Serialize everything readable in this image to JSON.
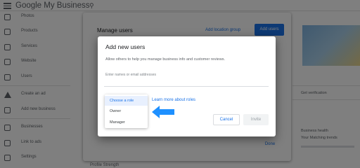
{
  "app": {
    "brand": "Google My Business"
  },
  "sidebar": {
    "items": [
      {
        "label": "Photos",
        "icon": "photo-icon"
      },
      {
        "label": "Products",
        "icon": "products-icon"
      },
      {
        "label": "Services",
        "icon": "services-icon"
      },
      {
        "label": "Website",
        "icon": "website-icon"
      },
      {
        "label": "Users",
        "icon": "users-icon"
      },
      {
        "label": "Create an ad",
        "icon": "ads-icon"
      },
      {
        "label": "Add new business",
        "icon": "add-business-icon"
      },
      {
        "label": "Businesses",
        "icon": "businesses-icon"
      },
      {
        "label": "Link to ads",
        "icon": "link-icon"
      },
      {
        "label": "Settings",
        "icon": "settings-icon"
      }
    ]
  },
  "manage_users": {
    "title": "Manage users",
    "add_location_group": "Add location group",
    "add_users": "Add users",
    "done": "Done"
  },
  "right_panel": {
    "item1": "Get verification",
    "item2": "Business health",
    "item3": "Your Matching trends"
  },
  "bottom": {
    "text": "Profile Strength"
  },
  "dialog": {
    "title": "Add new users",
    "description": "Allow others to help you manage business info and customer reviews.",
    "input_placeholder": "Enter names or email addresses",
    "input_value": "",
    "learn_more": "Learn more about roles",
    "cancel": "Cancel",
    "invite": "Invite"
  },
  "role_menu": {
    "selected": "Choose a role",
    "options": [
      "Choose a role",
      "Owner",
      "Manager"
    ]
  },
  "colors": {
    "accent": "#1a73e8",
    "arrow": "#1e90ff",
    "scrim": "rgba(0,0,0,0.5)"
  }
}
